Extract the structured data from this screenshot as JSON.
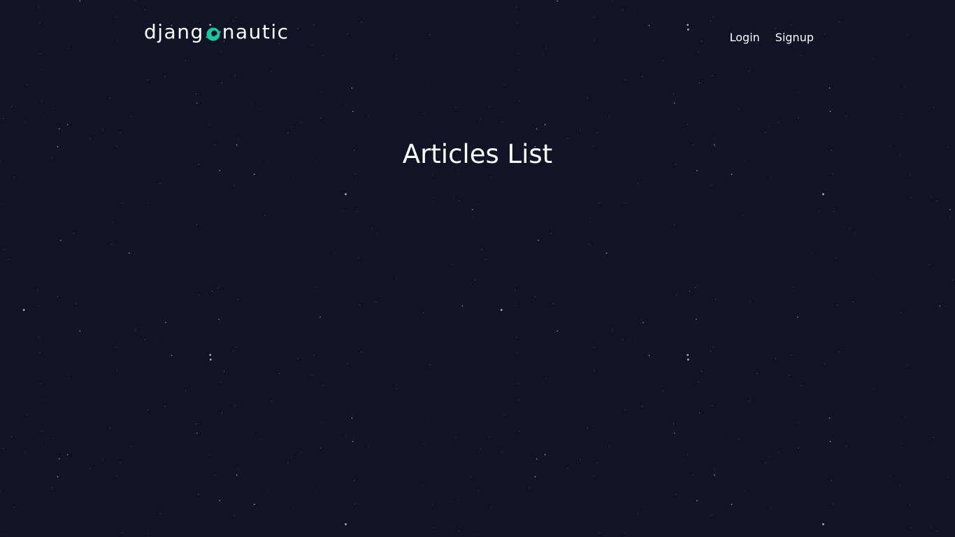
{
  "header": {
    "logo": {
      "text_before": "djang",
      "icon": "planet-o-icon",
      "text_after": "nautic",
      "accent_color": "#1ec59a"
    },
    "nav": {
      "login_label": "Login",
      "signup_label": "Signup"
    }
  },
  "main": {
    "title": "Articles List"
  },
  "colors": {
    "background": "#101426",
    "text": "#ffffff",
    "stars": "#c8cbe0"
  }
}
